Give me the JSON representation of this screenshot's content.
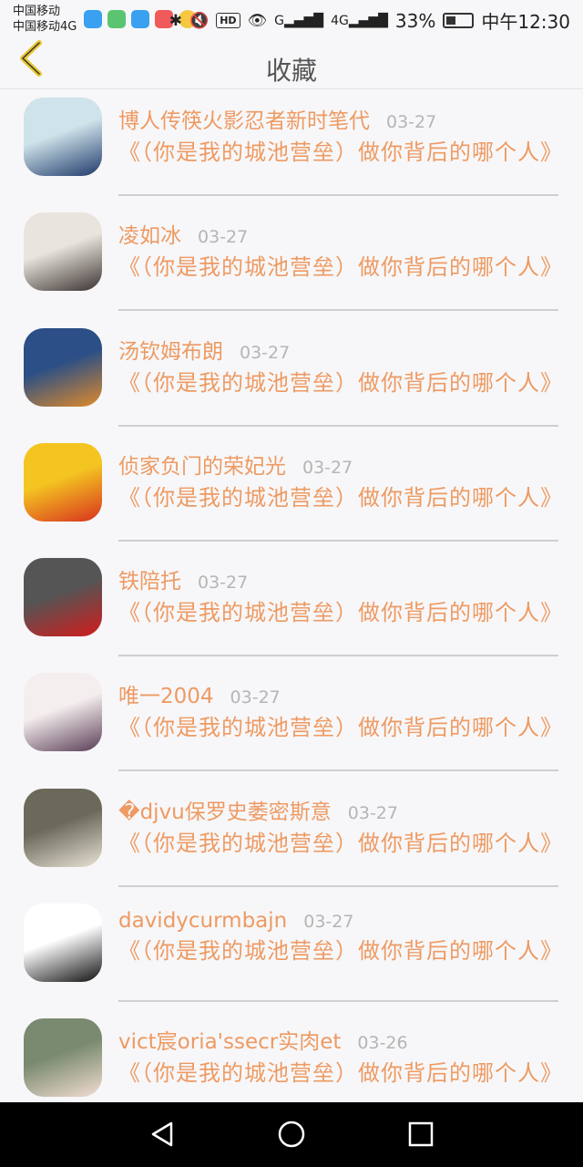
{
  "status_bar": {
    "carrier_1": "中国移动",
    "carrier_2": "中国移动4G",
    "hd_badge": "HD",
    "net_g": "G",
    "net_4g": "4G",
    "battery_percent": "33%",
    "time": "中午12:30",
    "app_colors": [
      "#3aa0f0",
      "#5bc470",
      "#3aa0f0",
      "#f05a5a",
      "#f5c842"
    ]
  },
  "header": {
    "title": "收藏",
    "back_icon": "chevron-left-icon",
    "accent": "#e8c531"
  },
  "colors": {
    "name": "#ee9a62",
    "date": "#b5b5b5",
    "divider": "#cfcfcf"
  },
  "items": [
    {
      "name": "博人传筷火影忍者新时笔代",
      "date": "03-27",
      "message": "《（你是我的城池营垒）做你背后的哪个人》",
      "avatar_colors": [
        "#cfe3ea",
        "#1f3a6a"
      ]
    },
    {
      "name": "凌如冰",
      "date": "03-27",
      "message": "《（你是我的城池营垒）做你背后的哪个人》",
      "avatar_colors": [
        "#e9e4de",
        "#3a3330"
      ]
    },
    {
      "name": "汤钦姆布朗",
      "date": "03-27",
      "message": "《（你是我的城池营垒）做你背后的哪个人》",
      "avatar_colors": [
        "#2b4f86",
        "#e08a2a"
      ]
    },
    {
      "name": "侦家负门的荣妃光",
      "date": "03-27",
      "message": "《（你是我的城池营垒）做你背后的哪个人》",
      "avatar_colors": [
        "#f4c521",
        "#d8321e"
      ]
    },
    {
      "name": "铁陪托",
      "date": "03-27",
      "message": "《（你是我的城池营垒）做你背后的哪个人》",
      "avatar_colors": [
        "#555555",
        "#d41b1b"
      ]
    },
    {
      "name": "唯一2004",
      "date": "03-27",
      "message": "《（你是我的城池营垒）做你背后的哪个人》",
      "avatar_colors": [
        "#f4eeee",
        "#5a3d55"
      ]
    },
    {
      "name": "�djvu保罗史萎密斯意",
      "date": "03-27",
      "message": "《（你是我的城池营垒）做你背后的哪个人》",
      "avatar_colors": [
        "#6b6a5a",
        "#e8e2d5"
      ]
    },
    {
      "name": "davidycurmbajn",
      "date": "03-27",
      "message": "《（你是我的城池营垒）做你背后的哪个人》",
      "avatar_colors": [
        "#ffffff",
        "#111111"
      ]
    },
    {
      "name": "vict宸oria'ssecr实肉et",
      "date": "03-26",
      "message": "《（你是我的城池营垒）做你背后的哪个人》",
      "avatar_colors": [
        "#7a8a70",
        "#f2ddd2"
      ]
    }
  ],
  "navbar": {
    "back_icon": "triangle-back-icon",
    "home_icon": "circle-home-icon",
    "recent_icon": "square-recent-icon"
  }
}
